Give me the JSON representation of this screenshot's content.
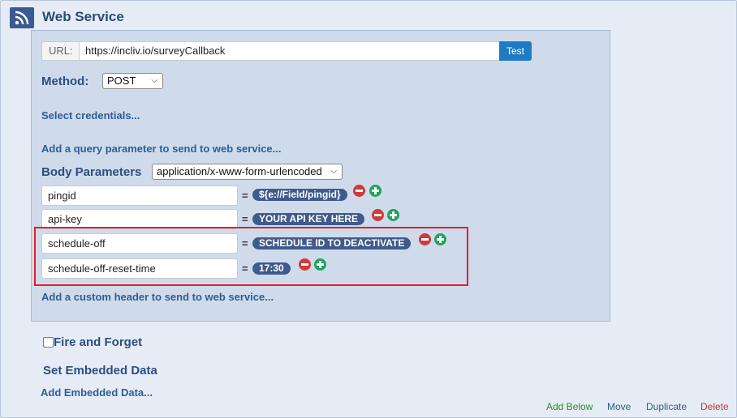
{
  "title": "Web Service",
  "url": {
    "label": "URL:",
    "value": "https://incliv.io/surveyCallback",
    "test_label": "Test"
  },
  "method": {
    "label": "Method:",
    "value": "POST"
  },
  "select_credentials": "Select credentials...",
  "add_query": "Add a query parameter to send to web service...",
  "body": {
    "label": "Body Parameters",
    "content_type": "application/x-www-form-urlencoded",
    "params": [
      {
        "key": "pingid",
        "value": "${e://Field/pingid}"
      },
      {
        "key": "api-key",
        "value": "YOUR API KEY HERE"
      },
      {
        "key": "schedule-off",
        "value": "SCHEDULE ID TO DEACTIVATE"
      },
      {
        "key": "schedule-off-reset-time",
        "value": "17:30"
      }
    ],
    "eq": "="
  },
  "add_header": "Add a custom header to send to web service...",
  "fire_and_forget": "Fire and Forget",
  "set_embedded": "Set Embedded Data",
  "add_embedded": "Add Embedded Data...",
  "actions": {
    "add_below": "Add Below",
    "move": "Move",
    "duplicate": "Duplicate",
    "delete": "Delete"
  },
  "colors": {
    "panel": "#cfdbea",
    "pill": "#3f5b8c",
    "highlight": "#e0202b",
    "test_button": "#1f7cc4"
  }
}
